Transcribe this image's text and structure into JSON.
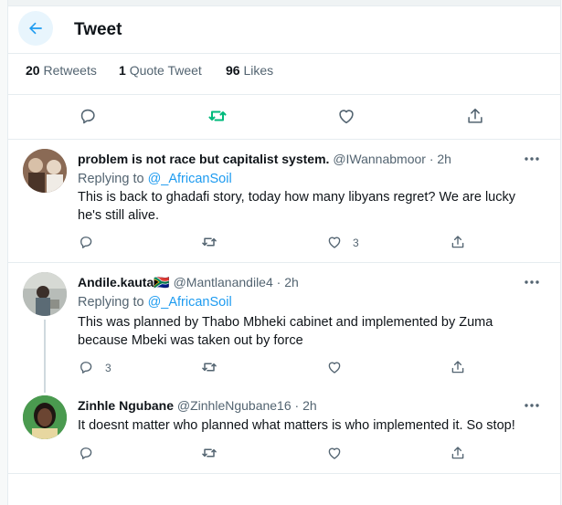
{
  "header": {
    "title": "Tweet"
  },
  "stats": {
    "retweets_count": "20",
    "retweets_label": "Retweets",
    "quotes_count": "1",
    "quotes_label": "Quote Tweet",
    "likes_count": "96",
    "likes_label": "Likes"
  },
  "colors": {
    "accent": "#1d9bf0",
    "retweet": "#00ba7c",
    "muted": "#536471",
    "border": "#e6ecf0"
  },
  "replies": [
    {
      "name": "problem is not race but capitalist system.",
      "meta": "@IWannabmoor · 2h",
      "replying_prefix": "Replying to",
      "replying_to": "@_AfricanSoil",
      "text": "This is back to ghadafi story, today how many libyans regret? We are lucky he's still alive.",
      "reply_count": "",
      "like_count": "3"
    },
    {
      "name": "Andile.kauta",
      "flag": "🇿🇦",
      "meta": "@Mantlanandile4 · 2h",
      "replying_prefix": "Replying to",
      "replying_to": "@_AfricanSoil",
      "text": "This was planned by Thabo Mbheki cabinet and implemented by Zuma because Mbeki was  taken out by force",
      "reply_count": "3",
      "like_count": ""
    },
    {
      "name": "Zinhle Ngubane",
      "meta": "@ZinhleNgubane16 · 2h",
      "text": "It doesnt matter who planned what matters is who implemented it. So stop!",
      "reply_count": "",
      "like_count": ""
    }
  ]
}
